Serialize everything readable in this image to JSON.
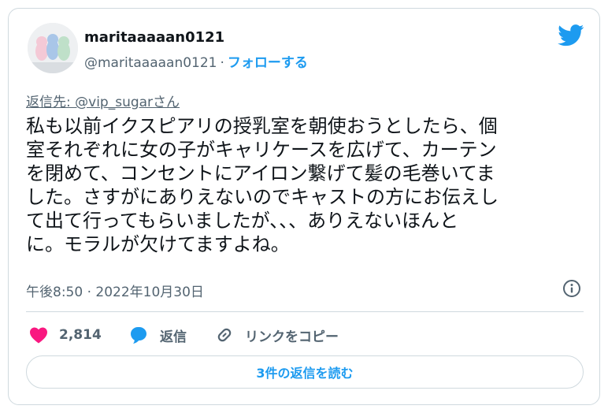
{
  "author": {
    "display_name": "maritaaaaan0121",
    "handle": "@maritaaaaan0121",
    "separator": "·",
    "follow_label": "フォローする"
  },
  "reply_to": "返信先: @vip_sugarさん",
  "tweet": {
    "lines": [
      "私も以前イクスピアリの授乳室を朝使おうとしたら、個",
      "室それぞれに女の子がキャリケースを広げて、カーテン",
      "を閉めて、コンセントにアイロン繋げて髪の毛巻いてま",
      "した。さすがにありえないのでキャストの方にお伝えし",
      "て出て行ってもらいましたが、、、ありえないほんと",
      "に。モラルが欠けてますよね。"
    ]
  },
  "timestamp": "午後8:50 · 2022年10月30日",
  "actions": {
    "like_count": "2,814",
    "reply_label": "返信",
    "copy_link_label": "リンクをコピー"
  },
  "read_replies_label": "3件の返信を読む",
  "colors": {
    "accent": "#1d9bf0",
    "heart": "#f91880",
    "muted": "#536471",
    "border": "#cfd9de"
  },
  "icons": [
    "twitter-bird-icon",
    "info-icon",
    "heart-icon",
    "reply-bubble-icon",
    "link-icon"
  ]
}
